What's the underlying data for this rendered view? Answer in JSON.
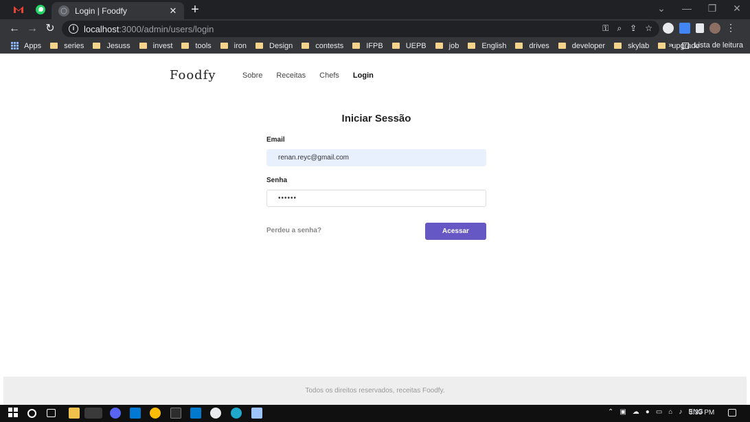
{
  "browser": {
    "tab_title": "Login | Foodfy",
    "tab_close": "✕",
    "new_tab": "+",
    "url_host": "localhost",
    "url_path": ":3000/admin/users/login",
    "window_controls": [
      "—",
      "❐",
      "✕"
    ],
    "bookmarks_apps": "Apps",
    "bookmarks": [
      "series",
      "Jesuss",
      "invest",
      "tools",
      "iron",
      "Design",
      "contests",
      "IFPB",
      "UEPB",
      "job",
      "English",
      "drives",
      "developer",
      "skylab",
      "upgrade"
    ],
    "bookmarks_more": "»",
    "reading_list": "Lista de leitura"
  },
  "site": {
    "logo": "Foodfy",
    "nav": [
      "Sobre",
      "Receitas",
      "Chefs",
      "Login"
    ],
    "active_nav": "Login"
  },
  "login": {
    "title": "Iniciar Sessão",
    "email_label": "Email",
    "email_value": "renan.reyc@gmail.com",
    "password_label": "Senha",
    "password_value": "••••••",
    "forgot_label": "Perdeu a senha?",
    "submit_label": "Acessar"
  },
  "footer": {
    "text": "Todos os direitos reservados, receitas Foodfy."
  },
  "taskbar": {
    "language": "ENG",
    "time": "3:33 PM"
  },
  "colors": {
    "accent": "#6558c4",
    "autofill": "#e8f0fe"
  }
}
